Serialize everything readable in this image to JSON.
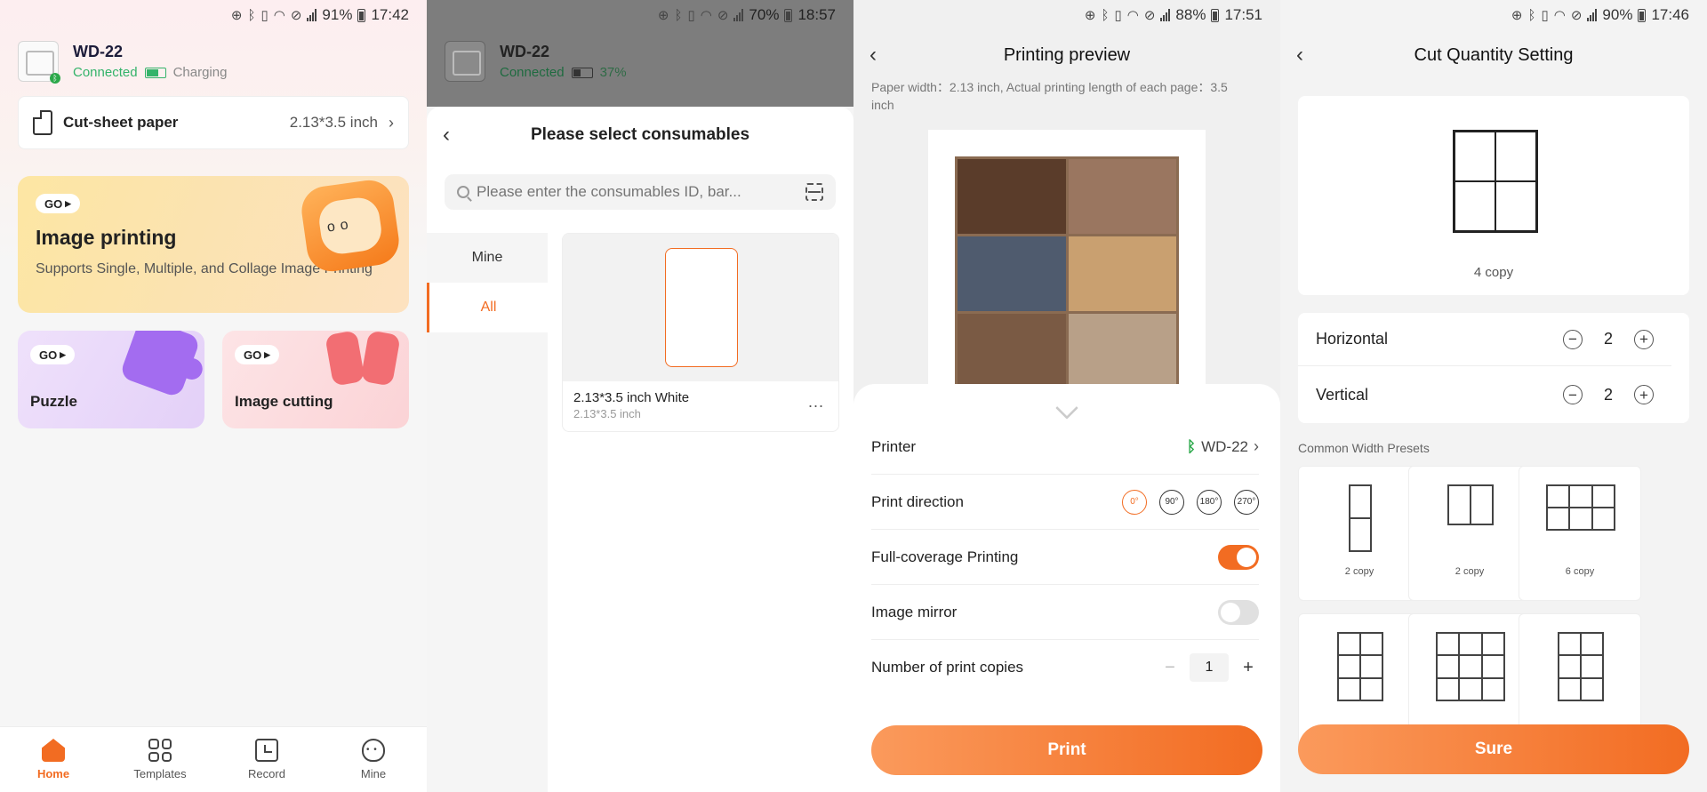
{
  "panel1": {
    "status": {
      "battery": "91%",
      "time": "17:42"
    },
    "device": {
      "name": "WD-22",
      "connection": "Connected",
      "power": "Charging"
    },
    "paper": {
      "label": "Cut-sheet paper",
      "size": "2.13*3.5 inch"
    },
    "cards": {
      "image_printing": {
        "go": "GO",
        "title": "Image printing",
        "desc": "Supports Single, Multiple, and Collage Image Printing"
      },
      "puzzle": {
        "go": "GO",
        "title": "Puzzle"
      },
      "cutting": {
        "go": "GO",
        "title": "Image cutting"
      }
    },
    "tabs": [
      {
        "label": "Home",
        "icon": "home-icon",
        "active": true
      },
      {
        "label": "Templates",
        "icon": "templates-icon"
      },
      {
        "label": "Record",
        "icon": "record-icon"
      },
      {
        "label": "Mine",
        "icon": "mine-icon"
      }
    ]
  },
  "panel2": {
    "status": {
      "battery": "70%",
      "time": "18:57"
    },
    "device": {
      "name": "WD-22",
      "connection": "Connected",
      "battery": "37%"
    },
    "sheet_title": "Please select consumables",
    "search_placeholder": "Please enter the consumables ID, bar...",
    "categories": [
      "Mine",
      "All"
    ],
    "active_category": "All",
    "consumable": {
      "title": "2.13*3.5 inch White",
      "size": "2.13*3.5 inch",
      "more": "..."
    }
  },
  "panel3": {
    "status": {
      "battery": "88%",
      "time": "17:51"
    },
    "title": "Printing preview",
    "info": "Paper width：2.13 inch,  Actual printing length of each page：3.5 inch",
    "printer_label": "Printer",
    "printer_value": "WD-22",
    "direction_label": "Print direction",
    "directions": [
      "0°",
      "90°",
      "180°",
      "270°"
    ],
    "active_direction": "0°",
    "full_coverage_label": "Full-coverage Printing",
    "full_coverage_on": true,
    "mirror_label": "Image mirror",
    "mirror_on": false,
    "copies_label": "Number of print copies",
    "copies": "1",
    "print_button": "Print",
    "accent": "#f26c22"
  },
  "panel4": {
    "status": {
      "battery": "90%",
      "time": "17:46"
    },
    "title": "Cut Quantity Setting",
    "preview_copies": "4 copy",
    "horizontal_label": "Horizontal",
    "horizontal": "2",
    "vertical_label": "Vertical",
    "vertical": "2",
    "presets_label": "Common Width Presets",
    "presets": [
      {
        "label": "2 copy",
        "cols": 1,
        "rows": 2
      },
      {
        "label": "2 copy",
        "cols": 2,
        "rows": 1
      },
      {
        "label": "6 copy",
        "cols": 3,
        "rows": 2
      },
      {
        "label": "",
        "cols": 2,
        "rows": 3
      },
      {
        "label": "",
        "cols": 3,
        "rows": 3
      },
      {
        "label": "",
        "cols": 2,
        "rows": 3
      }
    ],
    "sure_button": "Sure"
  }
}
